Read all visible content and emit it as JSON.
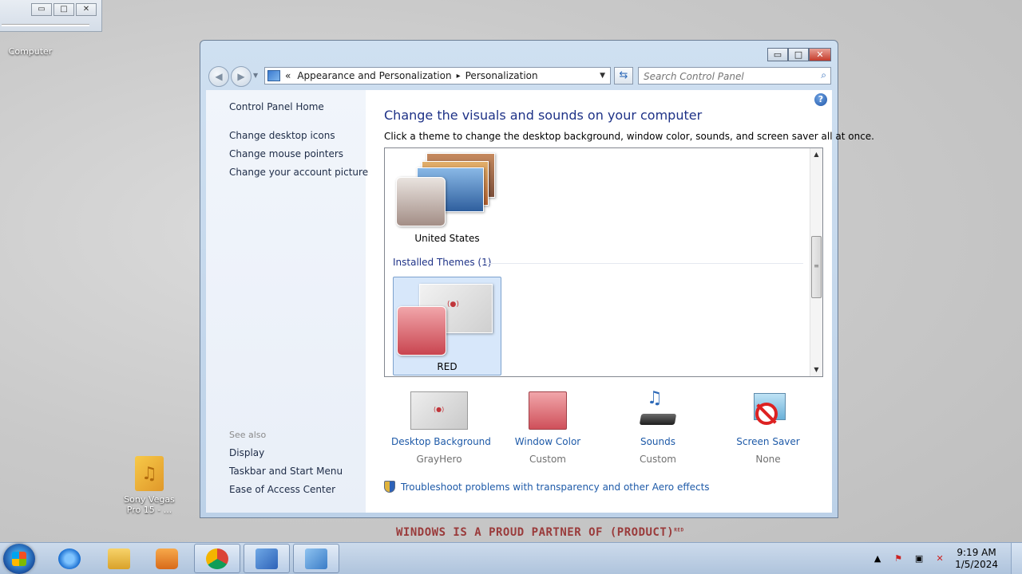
{
  "desktop": {
    "computer_label": "Computer",
    "sony_label_line1": "Sony Vegas",
    "sony_label_line2": "Pro 15 - ...",
    "partner_text": "WINDOWS IS A PROUD PARTNER OF (PRODUCT)",
    "partner_sup": "RED"
  },
  "mini_window": {
    "min": "▭",
    "max": "□",
    "close": "✕"
  },
  "window": {
    "min": "▭",
    "max": "□",
    "close": "✕",
    "address": {
      "chevrons": "«",
      "crumb1": "Appearance and Personalization",
      "sep": "▸",
      "crumb2": "Personalization"
    },
    "search_placeholder": "Search Control Panel",
    "sidebar": {
      "home": "Control Panel Home",
      "links": [
        "Change desktop icons",
        "Change mouse pointers",
        "Change your account picture"
      ],
      "see_also": "See also",
      "see_also_links": [
        "Display",
        "Taskbar and Start Menu",
        "Ease of Access Center"
      ]
    },
    "main": {
      "title": "Change the visuals and sounds on your computer",
      "subtitle": "Click a theme to change the desktop background, window color, sounds, and screen saver all at once.",
      "help": "?",
      "themes": [
        {
          "name": "United States"
        },
        {
          "name": "RED",
          "selected": true
        }
      ],
      "installed_header": "Installed Themes (1)",
      "bottom_items": [
        {
          "title": "Desktop Background",
          "sub": "GrayHero",
          "icon": "desktop-background-icon"
        },
        {
          "title": "Window Color",
          "sub": "Custom",
          "icon": "window-color-icon"
        },
        {
          "title": "Sounds",
          "sub": "Custom",
          "icon": "sounds-icon"
        },
        {
          "title": "Screen Saver",
          "sub": "None",
          "icon": "screen-saver-icon"
        }
      ],
      "troubleshoot": "Troubleshoot problems with transparency and other Aero effects"
    }
  },
  "taskbar": {
    "time": "9:19 AM",
    "date": "1/5/2024",
    "apps": [
      "internet-explorer-icon",
      "windows-explorer-icon",
      "media-player-icon",
      "chrome-icon",
      "control-panel-icon",
      "remote-desktop-icon"
    ]
  },
  "colors": {
    "link_blue": "#1e5aa8",
    "title_blue": "#1e3287",
    "red_theme": "#d9666e"
  }
}
